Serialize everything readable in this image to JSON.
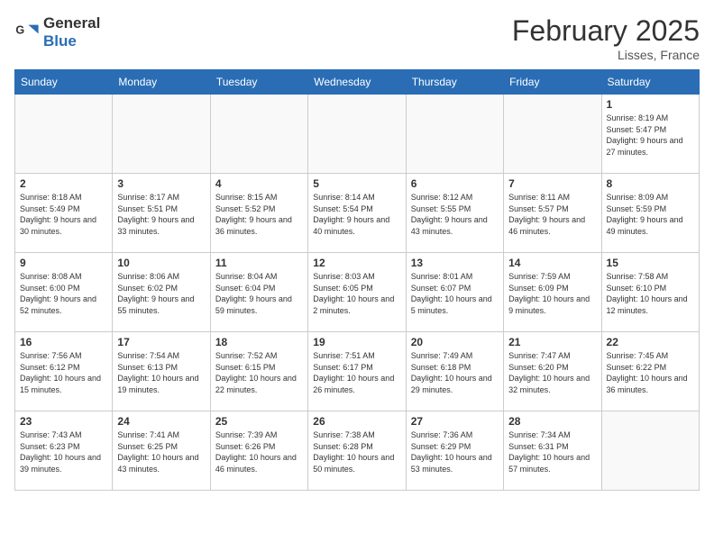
{
  "logo": {
    "text_general": "General",
    "text_blue": "Blue"
  },
  "header": {
    "month_year": "February 2025",
    "location": "Lisses, France"
  },
  "weekdays": [
    "Sunday",
    "Monday",
    "Tuesday",
    "Wednesday",
    "Thursday",
    "Friday",
    "Saturday"
  ],
  "weeks": [
    [
      {
        "day": "",
        "info": ""
      },
      {
        "day": "",
        "info": ""
      },
      {
        "day": "",
        "info": ""
      },
      {
        "day": "",
        "info": ""
      },
      {
        "day": "",
        "info": ""
      },
      {
        "day": "",
        "info": ""
      },
      {
        "day": "1",
        "info": "Sunrise: 8:19 AM\nSunset: 5:47 PM\nDaylight: 9 hours and 27 minutes."
      }
    ],
    [
      {
        "day": "2",
        "info": "Sunrise: 8:18 AM\nSunset: 5:49 PM\nDaylight: 9 hours and 30 minutes."
      },
      {
        "day": "3",
        "info": "Sunrise: 8:17 AM\nSunset: 5:51 PM\nDaylight: 9 hours and 33 minutes."
      },
      {
        "day": "4",
        "info": "Sunrise: 8:15 AM\nSunset: 5:52 PM\nDaylight: 9 hours and 36 minutes."
      },
      {
        "day": "5",
        "info": "Sunrise: 8:14 AM\nSunset: 5:54 PM\nDaylight: 9 hours and 40 minutes."
      },
      {
        "day": "6",
        "info": "Sunrise: 8:12 AM\nSunset: 5:55 PM\nDaylight: 9 hours and 43 minutes."
      },
      {
        "day": "7",
        "info": "Sunrise: 8:11 AM\nSunset: 5:57 PM\nDaylight: 9 hours and 46 minutes."
      },
      {
        "day": "8",
        "info": "Sunrise: 8:09 AM\nSunset: 5:59 PM\nDaylight: 9 hours and 49 minutes."
      }
    ],
    [
      {
        "day": "9",
        "info": "Sunrise: 8:08 AM\nSunset: 6:00 PM\nDaylight: 9 hours and 52 minutes."
      },
      {
        "day": "10",
        "info": "Sunrise: 8:06 AM\nSunset: 6:02 PM\nDaylight: 9 hours and 55 minutes."
      },
      {
        "day": "11",
        "info": "Sunrise: 8:04 AM\nSunset: 6:04 PM\nDaylight: 9 hours and 59 minutes."
      },
      {
        "day": "12",
        "info": "Sunrise: 8:03 AM\nSunset: 6:05 PM\nDaylight: 10 hours and 2 minutes."
      },
      {
        "day": "13",
        "info": "Sunrise: 8:01 AM\nSunset: 6:07 PM\nDaylight: 10 hours and 5 minutes."
      },
      {
        "day": "14",
        "info": "Sunrise: 7:59 AM\nSunset: 6:09 PM\nDaylight: 10 hours and 9 minutes."
      },
      {
        "day": "15",
        "info": "Sunrise: 7:58 AM\nSunset: 6:10 PM\nDaylight: 10 hours and 12 minutes."
      }
    ],
    [
      {
        "day": "16",
        "info": "Sunrise: 7:56 AM\nSunset: 6:12 PM\nDaylight: 10 hours and 15 minutes."
      },
      {
        "day": "17",
        "info": "Sunrise: 7:54 AM\nSunset: 6:13 PM\nDaylight: 10 hours and 19 minutes."
      },
      {
        "day": "18",
        "info": "Sunrise: 7:52 AM\nSunset: 6:15 PM\nDaylight: 10 hours and 22 minutes."
      },
      {
        "day": "19",
        "info": "Sunrise: 7:51 AM\nSunset: 6:17 PM\nDaylight: 10 hours and 26 minutes."
      },
      {
        "day": "20",
        "info": "Sunrise: 7:49 AM\nSunset: 6:18 PM\nDaylight: 10 hours and 29 minutes."
      },
      {
        "day": "21",
        "info": "Sunrise: 7:47 AM\nSunset: 6:20 PM\nDaylight: 10 hours and 32 minutes."
      },
      {
        "day": "22",
        "info": "Sunrise: 7:45 AM\nSunset: 6:22 PM\nDaylight: 10 hours and 36 minutes."
      }
    ],
    [
      {
        "day": "23",
        "info": "Sunrise: 7:43 AM\nSunset: 6:23 PM\nDaylight: 10 hours and 39 minutes."
      },
      {
        "day": "24",
        "info": "Sunrise: 7:41 AM\nSunset: 6:25 PM\nDaylight: 10 hours and 43 minutes."
      },
      {
        "day": "25",
        "info": "Sunrise: 7:39 AM\nSunset: 6:26 PM\nDaylight: 10 hours and 46 minutes."
      },
      {
        "day": "26",
        "info": "Sunrise: 7:38 AM\nSunset: 6:28 PM\nDaylight: 10 hours and 50 minutes."
      },
      {
        "day": "27",
        "info": "Sunrise: 7:36 AM\nSunset: 6:29 PM\nDaylight: 10 hours and 53 minutes."
      },
      {
        "day": "28",
        "info": "Sunrise: 7:34 AM\nSunset: 6:31 PM\nDaylight: 10 hours and 57 minutes."
      },
      {
        "day": "",
        "info": ""
      }
    ]
  ]
}
